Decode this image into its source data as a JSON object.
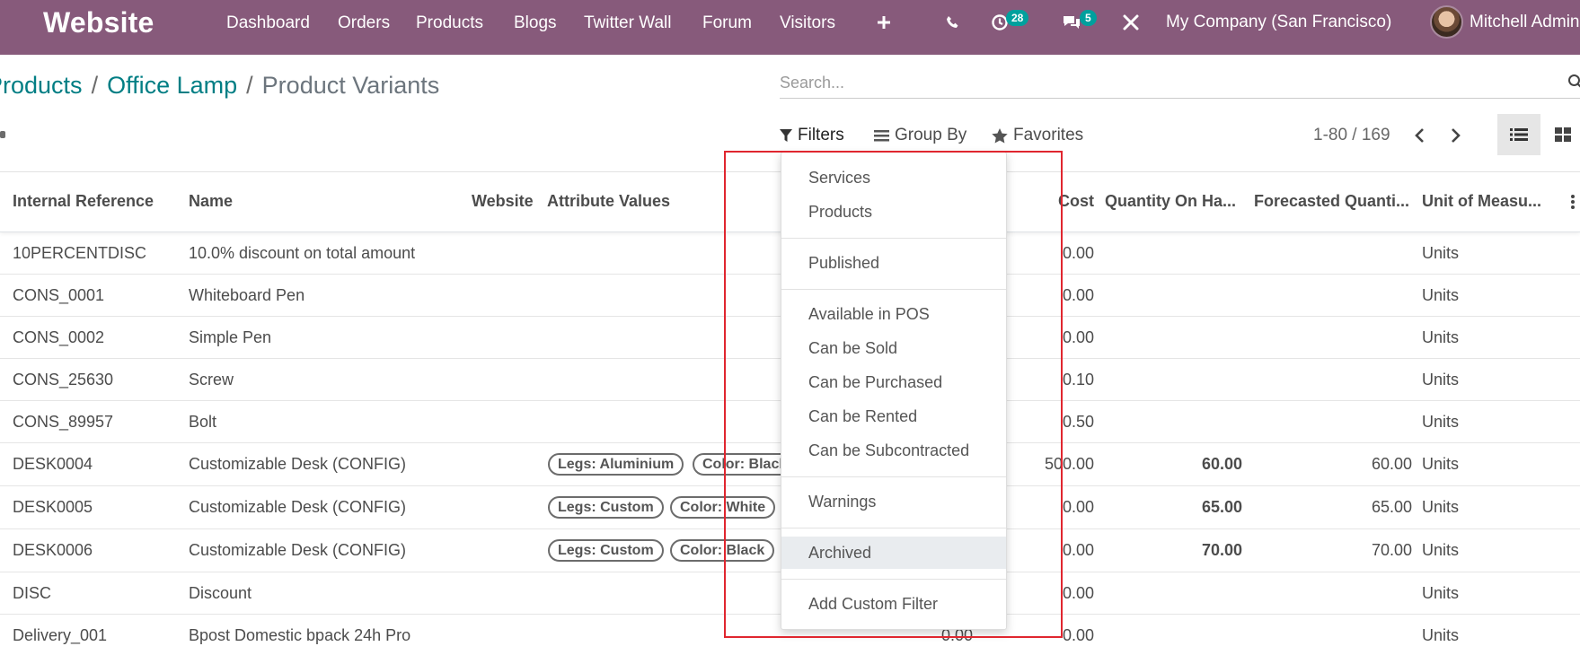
{
  "navbar": {
    "brand": "Website",
    "menu": [
      "Dashboard",
      "Orders",
      "Products",
      "Blogs",
      "Twitter Wall",
      "Forum",
      "Visitors"
    ],
    "activities_count": "28",
    "messages_count": "5",
    "company": "My Company (San Francisco)",
    "user": "Mitchell Admin"
  },
  "breadcrumb": {
    "items": [
      "Products",
      "Office Lamp"
    ],
    "current": "Product Variants"
  },
  "search": {
    "placeholder": "Search..."
  },
  "search_panel": {
    "filters_label": "Filters",
    "group_by_label": "Group By",
    "favorites_label": "Favorites"
  },
  "pager": {
    "range": "1-80 / 169"
  },
  "table": {
    "columns": {
      "internal_reference": "Internal Reference",
      "name": "Name",
      "website": "Website",
      "attribute_values": "Attribute Values",
      "cost": "Cost",
      "quantity_on_hand": "Quantity On Ha...",
      "forecasted_quantity": "Forecasted Quanti...",
      "unit_of_measure": "Unit of Measu..."
    },
    "rows": [
      {
        "ref": "10PERCENTDISC",
        "name": "10.0% discount on total amount",
        "tags": [],
        "sales": "",
        "cost": "0.00",
        "qty": "",
        "forecast": "",
        "uom": "Units"
      },
      {
        "ref": "CONS_0001",
        "name": "Whiteboard Pen",
        "tags": [],
        "sales": "",
        "cost": "0.00",
        "qty": "",
        "forecast": "",
        "uom": "Units"
      },
      {
        "ref": "CONS_0002",
        "name": "Simple Pen",
        "tags": [],
        "sales": "",
        "cost": "0.00",
        "qty": "",
        "forecast": "",
        "uom": "Units"
      },
      {
        "ref": "CONS_25630",
        "name": "Screw",
        "tags": [],
        "sales": "",
        "cost": "0.10",
        "qty": "",
        "forecast": "",
        "uom": "Units"
      },
      {
        "ref": "CONS_89957",
        "name": "Bolt",
        "tags": [],
        "sales": "",
        "cost": "0.50",
        "qty": "",
        "forecast": "",
        "uom": "Units"
      },
      {
        "ref": "DESK0004",
        "name": "Customizable Desk (CONFIG)",
        "tags": [
          "Legs: Aluminium",
          "Color: Black"
        ],
        "sales": "",
        "cost": "500.00",
        "qty": "60.00",
        "forecast": "60.00",
        "uom": "Units"
      },
      {
        "ref": "DESK0005",
        "name": "Customizable Desk (CONFIG)",
        "tags": [
          "Legs: Custom",
          "Color: White"
        ],
        "sales": "",
        "cost": "0.00",
        "qty": "65.00",
        "forecast": "65.00",
        "uom": "Units"
      },
      {
        "ref": "DESK0006",
        "name": "Customizable Desk (CONFIG)",
        "tags": [
          "Legs: Custom",
          "Color: Black"
        ],
        "sales": "",
        "cost": "0.00",
        "qty": "70.00",
        "forecast": "70.00",
        "uom": "Units"
      },
      {
        "ref": "DISC",
        "name": "Discount",
        "tags": [],
        "sales": "",
        "cost": "0.00",
        "qty": "",
        "forecast": "",
        "uom": "Units"
      },
      {
        "ref": "Delivery_001",
        "name": "Bpost Domestic bpack 24h Pro",
        "tags": [],
        "sales": "0.00",
        "cost": "0.00",
        "qty": "",
        "forecast": "",
        "uom": "Units"
      }
    ]
  },
  "filters_dropdown": {
    "groups": [
      [
        "Services",
        "Products"
      ],
      [
        "Published"
      ],
      [
        "Available in POS",
        "Can be Sold",
        "Can be Purchased",
        "Can be Rented",
        "Can be Subcontracted"
      ],
      [
        "Warnings"
      ],
      [
        "Archived"
      ],
      [
        "Add Custom Filter"
      ]
    ],
    "selected": "Archived"
  },
  "colors": {
    "navbar": "#875a7b",
    "link": "#017e84",
    "badge": "#00a09d",
    "highlight": "#e0262f"
  },
  "icons": [
    "plus-icon",
    "phone-icon",
    "clock-icon",
    "chat-icon",
    "tools-icon",
    "filter-icon",
    "list-icon",
    "star-icon",
    "chevron-left-icon",
    "chevron-right-icon",
    "list-view-icon",
    "kanban-view-icon",
    "search-icon",
    "column-options-icon"
  ]
}
